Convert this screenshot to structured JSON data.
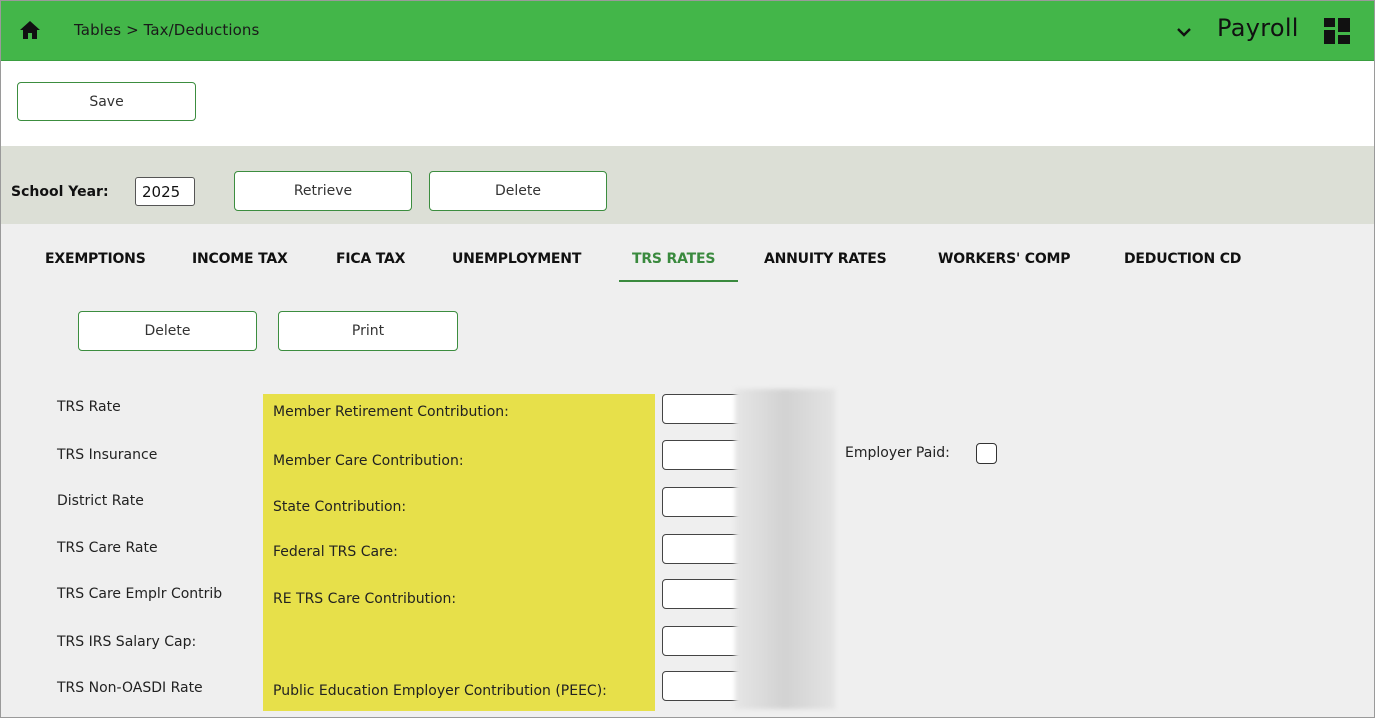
{
  "header": {
    "breadcrumb": "Tables > Tax/Deductions",
    "app_title": "Payroll",
    "color": "#43b649",
    "icons": [
      "home-icon",
      "chevron-down-icon",
      "grid-icon"
    ]
  },
  "toolbar": {
    "save_label": "Save"
  },
  "school_year": {
    "label": "School Year:",
    "value": "2025",
    "retrieve_label": "Retrieve",
    "delete_label": "Delete"
  },
  "tabs": [
    {
      "label": "EXEMPTIONS"
    },
    {
      "label": "INCOME TAX"
    },
    {
      "label": "FICA TAX"
    },
    {
      "label": "UNEMPLOYMENT"
    },
    {
      "label": "TRS RATES"
    },
    {
      "label": "ANNUITY RATES"
    },
    {
      "label": "WORKERS' COMP"
    },
    {
      "label": "DEDUCTION CD"
    }
  ],
  "active_tab": "TRS RATES",
  "actions": {
    "delete_label": "Delete",
    "print_label": "Print"
  },
  "rows": [
    {
      "label": "TRS Rate",
      "field": "Member Retirement Contribution:",
      "value": ""
    },
    {
      "label": "TRS Insurance",
      "field": "Member Care Contribution:",
      "value": ""
    },
    {
      "label": "District Rate",
      "field": "State Contribution:",
      "value": ""
    },
    {
      "label": "TRS Care Rate",
      "field": "Federal TRS Care:",
      "value": ""
    },
    {
      "label": "TRS Care Emplr Contrib",
      "field": "RE TRS Care Contribution:",
      "value": ""
    },
    {
      "label": "TRS IRS Salary Cap:",
      "field": "",
      "value": ""
    },
    {
      "label": "TRS Non-OASDI Rate",
      "field": "Public Education Employer Contribution (PEEC):",
      "value": ""
    }
  ],
  "employer_paid": {
    "label": "Employer Paid:",
    "checked": false
  },
  "colors": {
    "accent": "#3a8a3e",
    "highlight": "#e7e04a",
    "band": "#dcdfd6"
  }
}
